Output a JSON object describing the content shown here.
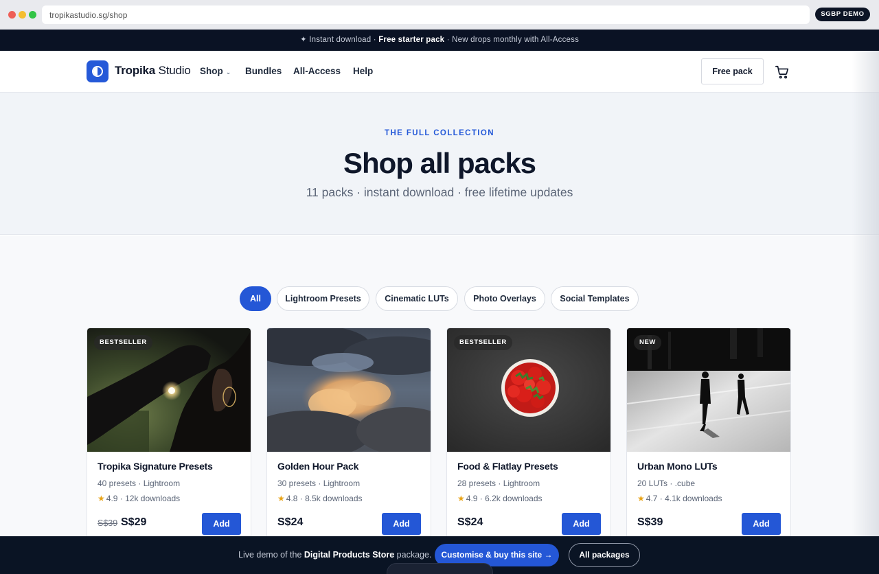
{
  "browser": {
    "url": "tropikastudio.sg/shop",
    "badge": "SGBP DEMO"
  },
  "announcement": {
    "part1": "✦ Instant download · ",
    "bold": "Free starter pack",
    "part2": " · New drops monthly with All-Access"
  },
  "header": {
    "brand_bold": "Tropika",
    "brand_rest": " Studio",
    "nav": {
      "shop": "Shop",
      "bundles": "Bundles",
      "all_access": "All-Access",
      "help": "Help"
    },
    "free_pack": "Free pack"
  },
  "hero": {
    "eyebrow": "THE FULL COLLECTION",
    "title": "Shop all packs",
    "subtitle": "11 packs · instant download · free lifetime updates"
  },
  "filters": [
    "All",
    "Lightroom Presets",
    "Cinematic LUTs",
    "Photo Overlays",
    "Social Templates"
  ],
  "products": [
    {
      "badge": "BESTSELLER",
      "name": "Tropika Signature Presets",
      "meta": "40 presets · Lightroom",
      "rating": "4.9 · 12k downloads",
      "old_price": "S$39",
      "price": "S$29",
      "add": "Add"
    },
    {
      "badge": "",
      "name": "Golden Hour Pack",
      "meta": "30 presets · Lightroom",
      "rating": "4.8 · 8.5k downloads",
      "old_price": "",
      "price": "S$24",
      "add": "Add"
    },
    {
      "badge": "BESTSELLER",
      "name": "Food & Flatlay Presets",
      "meta": "28 presets · Lightroom",
      "rating": "4.9 · 6.2k downloads",
      "old_price": "",
      "price": "S$24",
      "add": "Add"
    },
    {
      "badge": "NEW",
      "name": "Urban Mono LUTs",
      "meta": "20 LUTs · .cube",
      "rating": "4.7 · 4.1k downloads",
      "old_price": "",
      "price": "S$39",
      "add": "Add"
    }
  ],
  "demo_bar": {
    "text_pre": "Live demo of the ",
    "text_bold": "Digital Products Store",
    "text_post": " package.",
    "customise": "Customise & buy this site →",
    "all_packages": "All packages"
  },
  "colors": {
    "accent": "#2457d6",
    "dark": "#0a1224",
    "star": "#e8a317"
  }
}
